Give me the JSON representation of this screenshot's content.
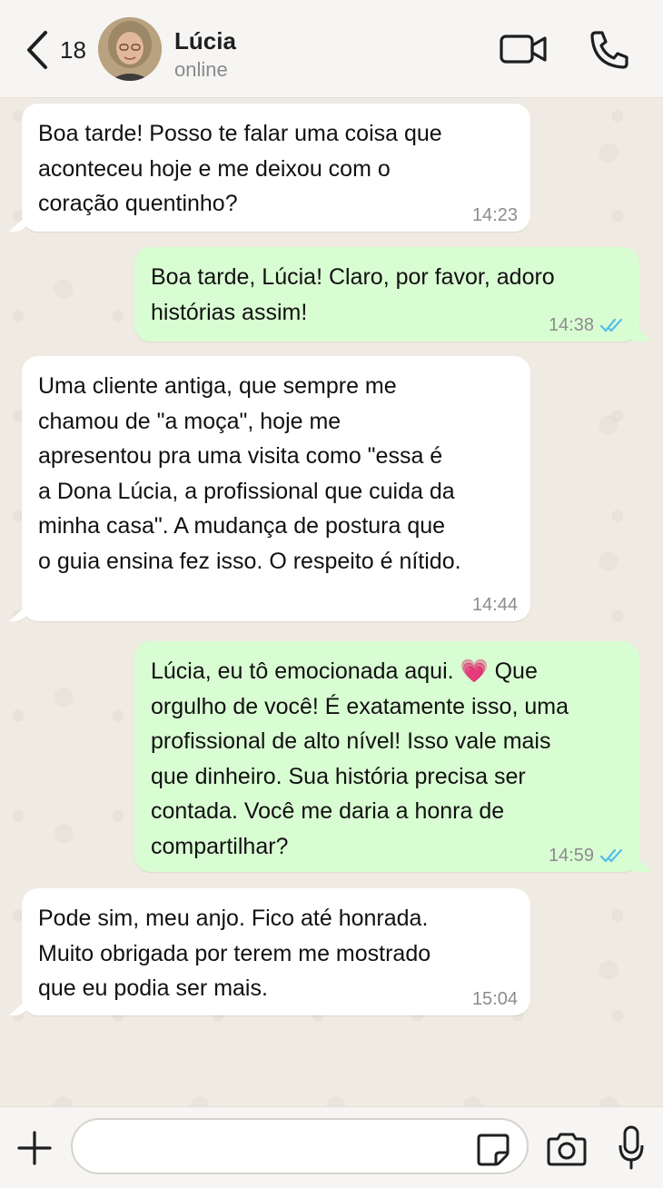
{
  "header": {
    "back_count": "18",
    "contact_name": "Lúcia",
    "contact_status": "online",
    "icons": [
      "chevron-left-icon",
      "video-call-icon",
      "phone-icon"
    ]
  },
  "messages": [
    {
      "direction": "incoming",
      "lines": [
        "Boa tarde! Posso te falar uma coisa que",
        "aconteceu hoje e me deixou com o",
        "coração quentinho?"
      ],
      "time": "14:23"
    },
    {
      "direction": "outgoing",
      "lines": [
        "Boa tarde, Lúcia! Claro, por favor, adoro",
        "histórias assim!"
      ],
      "time": "14:38",
      "status": "read"
    },
    {
      "direction": "incoming",
      "lines": [
        "Uma cliente antiga, que sempre me",
        "chamou de \"a moça\", hoje me",
        "apresentou pra uma visita como \"essa é",
        "a Dona Lúcia, a profissional que cuida da",
        "minha casa\". A mudança de postura que",
        "o guia ensina fez isso. O respeito é nítido."
      ],
      "time": "14:44"
    },
    {
      "direction": "outgoing",
      "lines": [
        "Lúcia, eu tô emocionada aqui. 💗 Que",
        "orgulho de você! É exatamente isso, uma",
        "profissional de alto nível! Isso vale mais",
        "que dinheiro. Sua história precisa ser",
        "contada. Você me daria a honra de",
        "compartilhar?"
      ],
      "time": "14:59",
      "status": "read"
    },
    {
      "direction": "incoming",
      "lines": [
        "Pode sim, meu anjo. Fico até honrada.",
        "Muito obrigada por terem me mostrado",
        "que eu podia ser mais."
      ],
      "time": "15:04"
    }
  ],
  "footer": {
    "message_value": "",
    "icons": [
      "plus-icon",
      "sticker-icon",
      "camera-icon",
      "microphone-icon"
    ]
  },
  "colors": {
    "incoming_bubble": "#ffffff",
    "outgoing_bubble": "#d9fdd3",
    "read_ticks": "#53bdeb",
    "chat_background": "#efeae2"
  }
}
